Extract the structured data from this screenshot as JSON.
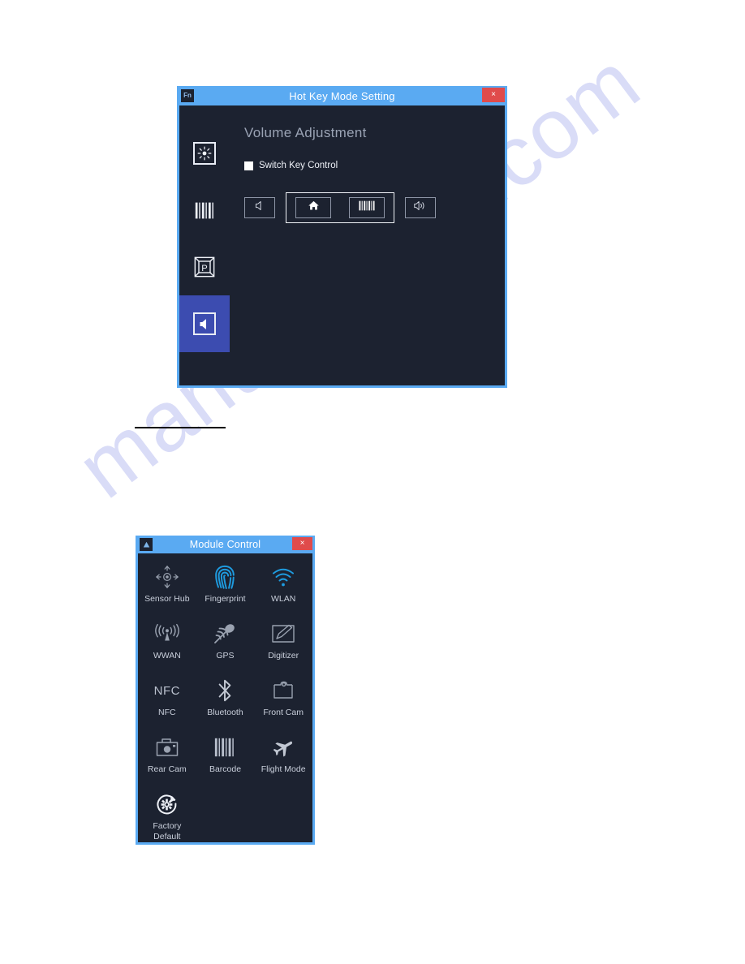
{
  "page": {
    "background_color": "#ffffff",
    "watermark_text": "manualshive.com",
    "watermark_color": "#d9dcf7"
  },
  "hotkey_window": {
    "app_icon": "fn-icon",
    "app_icon_text": "Fn",
    "title": "Hot Key Mode Setting",
    "close_label": "×",
    "title_bar_color": "#5aaaf2",
    "body_color": "#1c2230",
    "selected_tab_color": "#3c4cb0",
    "tabs": [
      {
        "name": "brightness",
        "icon": "brightness-sun-icon",
        "selected": false
      },
      {
        "name": "barcode",
        "icon": "barcode-icon",
        "selected": false
      },
      {
        "name": "programmable-key",
        "icon": "p-key-icon",
        "selected": false
      },
      {
        "name": "volume",
        "icon": "volume-speaker-icon",
        "selected": true
      }
    ],
    "heading": "Volume Adjustment",
    "checkbox": {
      "label": "Switch Key Control",
      "checked": false
    },
    "buttons": [
      {
        "name": "volume-down-button",
        "icon": "speaker-mute-icon",
        "grouped": false
      },
      {
        "name": "home-button",
        "icon": "home-icon",
        "grouped": true
      },
      {
        "name": "barcode-button",
        "icon": "barcode-icon",
        "grouped": true
      },
      {
        "name": "volume-up-button",
        "icon": "speaker-waves-icon",
        "grouped": false
      }
    ]
  },
  "module_window": {
    "app_icon": "module-icon",
    "title": "Module Control",
    "close_label": "×",
    "title_bar_color": "#5aaaf2",
    "body_color": "#1c2230",
    "enabled_color": "#1e9bdf",
    "disabled_color": "#9aa2b0",
    "modules": [
      {
        "label": "Sensor Hub",
        "icon": "sensor-hub-icon",
        "enabled": false
      },
      {
        "label": "Fingerprint",
        "icon": "fingerprint-icon",
        "enabled": true
      },
      {
        "label": "WLAN",
        "icon": "wifi-icon",
        "enabled": true
      },
      {
        "label": "WWAN",
        "icon": "antenna-tower-icon",
        "enabled": false
      },
      {
        "label": "GPS",
        "icon": "satellite-dish-icon",
        "enabled": false
      },
      {
        "label": "Digitizer",
        "icon": "pen-tablet-icon",
        "enabled": false
      },
      {
        "label": "NFC",
        "icon": "nfc-text-icon",
        "enabled": false
      },
      {
        "label": "Bluetooth",
        "icon": "bluetooth-icon",
        "enabled": false
      },
      {
        "label": "Front Cam",
        "icon": "front-camera-icon",
        "enabled": false
      },
      {
        "label": "Rear Cam",
        "icon": "rear-camera-icon",
        "enabled": false
      },
      {
        "label": "Barcode",
        "icon": "barcode-icon",
        "enabled": false
      },
      {
        "label": "Flight Mode",
        "icon": "airplane-icon",
        "enabled": false
      },
      {
        "label": "Factory\nDefault",
        "icon": "factory-reset-icon",
        "enabled": false
      }
    ]
  }
}
